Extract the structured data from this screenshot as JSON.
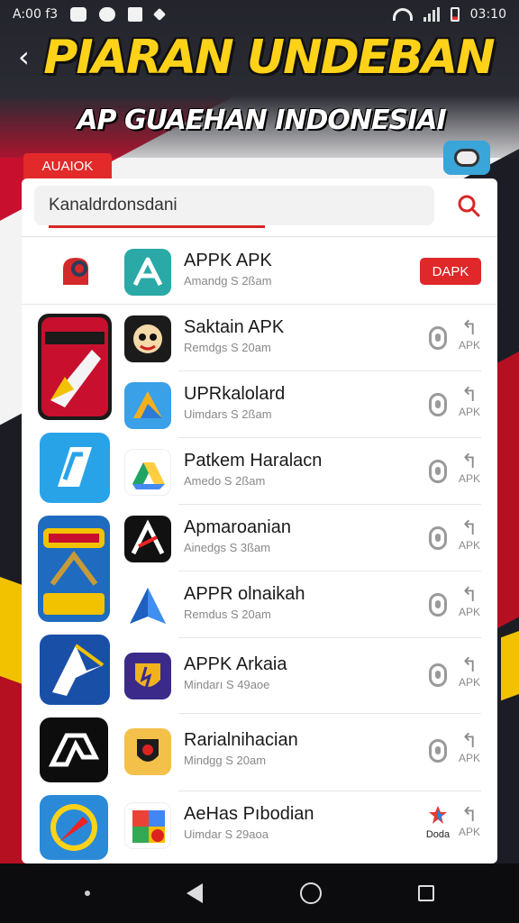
{
  "status_bar": {
    "left_text": "A:00 f3",
    "time": "03:10"
  },
  "header": {
    "back_symbol": "‹",
    "title": "PIARAN UNDEBAN",
    "subtitle": "AP GUAEHAN INDONESIAI"
  },
  "section_tag": "AUAIOK",
  "search": {
    "value": "Kanaldrdonsdani",
    "icon": "search-icon"
  },
  "promo": {
    "name": "APPK APK",
    "meta": "Amandg S 2ßam",
    "badge": "DAPK"
  },
  "apps": [
    {
      "name": "Saktain APK",
      "meta": "Remdgs S 20am",
      "share_label": "APK"
    },
    {
      "name": "UPRkalolard",
      "meta": "Uimdars S 2ßam",
      "share_label": "APK"
    },
    {
      "name": "Patkem Haralacn",
      "meta": "Amedo S 2ßam",
      "share_label": "APK"
    },
    {
      "name": "Apmaroanian",
      "meta": "Ainedgs S 3ßam",
      "share_label": "APK"
    },
    {
      "name": "APPR olnaikah",
      "meta": "Remdus S 20am",
      "share_label": "APK"
    },
    {
      "name": "APPK Arkaia",
      "meta": "Mindarı S 49aoe",
      "share_label": "APK"
    },
    {
      "name": "Rarialnihacian",
      "meta": "Mindgg S 20am",
      "share_label": "APK"
    },
    {
      "name": "AeHas Pıbodian",
      "meta": "Uimdar S 29aoa",
      "share_label": "APK"
    }
  ],
  "last_row_extra": "Doda",
  "colors": {
    "accent_red": "#e0272a",
    "title_yellow": "#ffd21a"
  }
}
